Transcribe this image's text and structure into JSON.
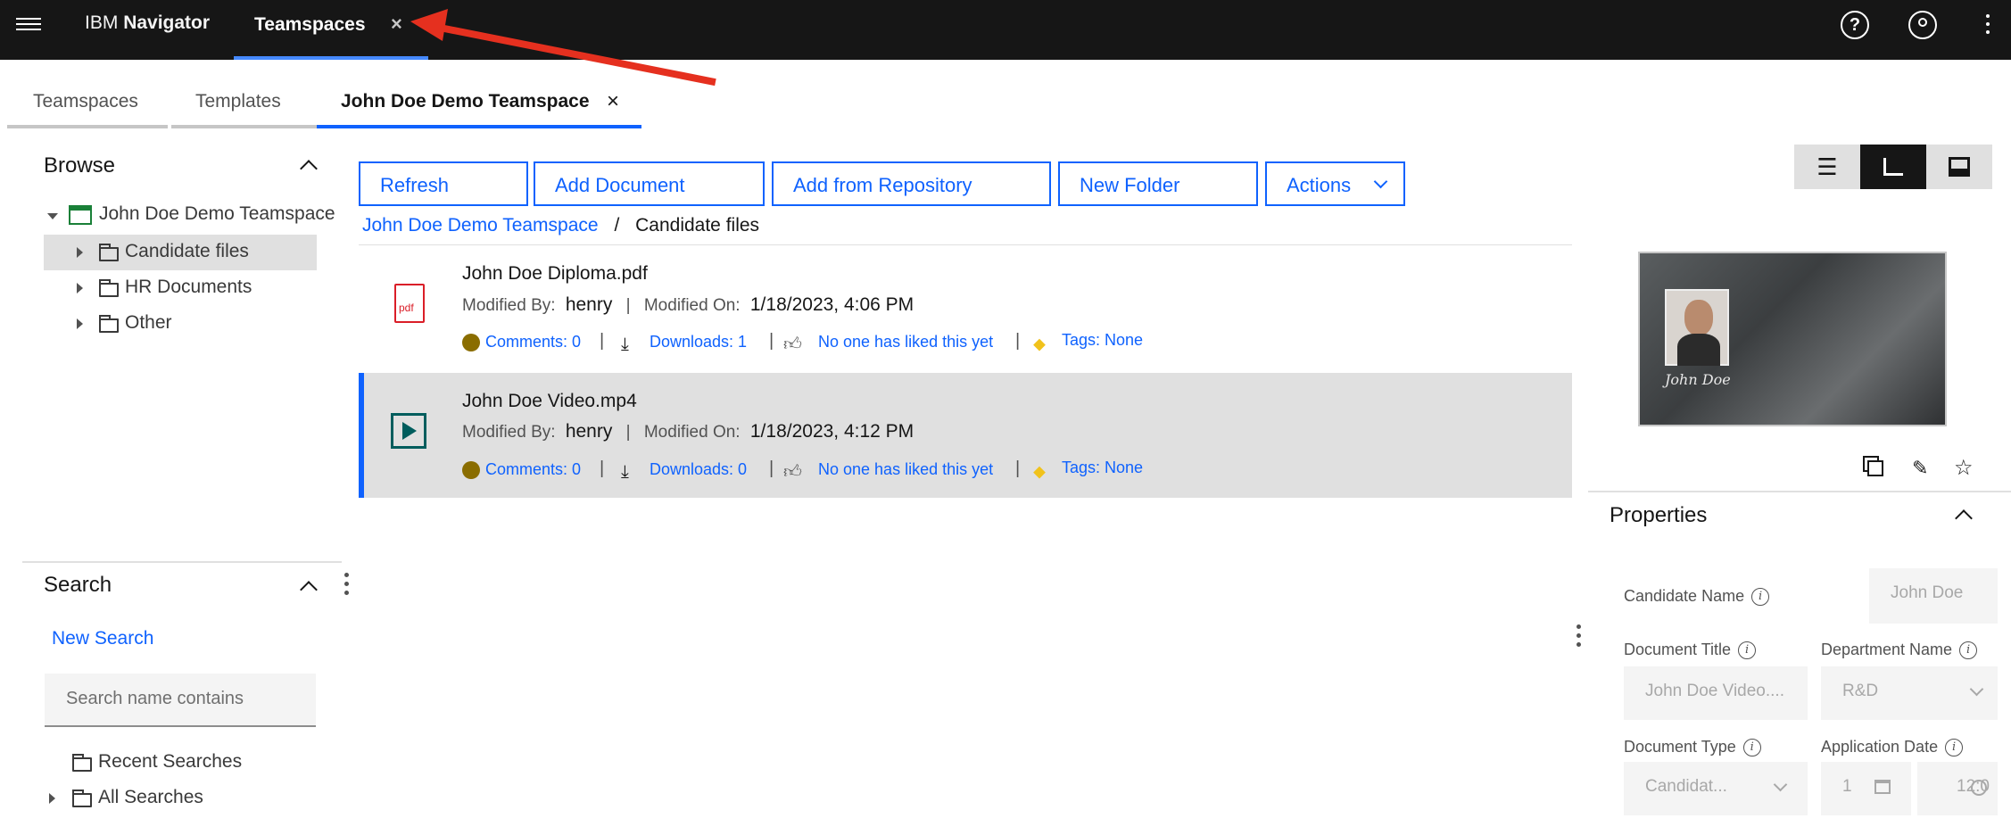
{
  "header": {
    "brand_prefix": "IBM",
    "brand_name": "Navigator",
    "active_tab": "Teamspaces",
    "close_symbol": "×"
  },
  "subtabs": [
    {
      "label": "Teamspaces"
    },
    {
      "label": "Templates"
    },
    {
      "label": "John Doe Demo Teamspace"
    }
  ],
  "browse": {
    "title": "Browse",
    "root": "John Doe Demo Teamspace",
    "folders": [
      {
        "label": "Candidate files"
      },
      {
        "label": "HR Documents"
      },
      {
        "label": "Other"
      }
    ]
  },
  "search": {
    "title": "Search",
    "new_search": "New Search",
    "placeholder": "Search name contains",
    "recent": "Recent Searches",
    "all": "All Searches"
  },
  "toolbar": {
    "refresh": "Refresh",
    "add_document": "Add Document",
    "add_from_repository": "Add from Repository",
    "new_folder": "New Folder",
    "actions": "Actions"
  },
  "breadcrumb": {
    "root": "John Doe Demo Teamspace",
    "separator": "/",
    "current": "Candidate files"
  },
  "files": [
    {
      "name": "John Doe Diploma.pdf",
      "modified_by_label": "Modified By:",
      "modified_by": "henry",
      "modified_on_label": "Modified On:",
      "modified_on": "1/18/2023, 4:06 PM",
      "comments": "Comments: 0",
      "downloads": "Downloads: 1",
      "likes": "No one has liked this yet",
      "tags": "Tags: None",
      "icon": "pdf-file-icon",
      "icon_text": "pdf"
    },
    {
      "name": "John Doe Video.mp4",
      "modified_by_label": "Modified By:",
      "modified_by": "henry",
      "modified_on_label": "Modified On:",
      "modified_on": "1/18/2023, 4:12 PM",
      "comments": "Comments: 0",
      "downloads": "Downloads: 0",
      "likes": "No one has liked this yet",
      "tags": "Tags: None",
      "icon": "video-file-icon"
    }
  ],
  "properties": {
    "title": "Properties",
    "candidate_name_label": "Candidate Name",
    "candidate_name": "John Doe",
    "document_title_label": "Document Title",
    "document_title": "John Doe Video....",
    "department_name_label": "Department Name",
    "department_name": "R&D",
    "document_type_label": "Document Type",
    "document_type": "Candidat...",
    "application_date_label": "Application Date",
    "application_date": "1",
    "application_time": "12:0"
  },
  "preview": {
    "signature": "John Doe"
  },
  "colors": {
    "accent": "#0f62fe",
    "topbar": "#161616",
    "annotation_arrow": "#e5301f"
  }
}
